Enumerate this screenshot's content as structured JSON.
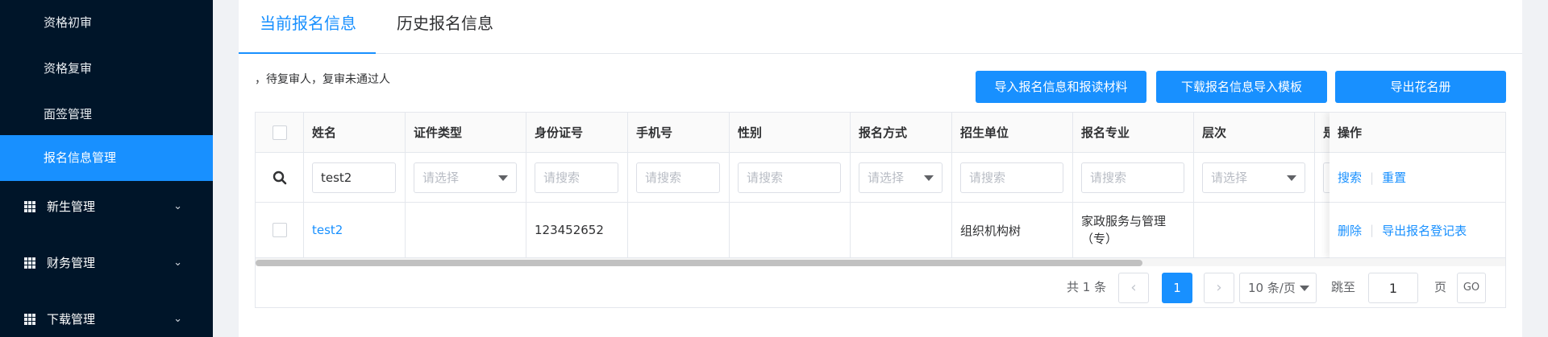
{
  "sidebar": {
    "sub_items": [
      {
        "label": "资格初审"
      },
      {
        "label": "资格复审"
      },
      {
        "label": "面签管理"
      },
      {
        "label": "报名信息管理"
      }
    ],
    "groups": [
      {
        "label": "新生管理"
      },
      {
        "label": "财务管理"
      },
      {
        "label": "下载管理"
      }
    ]
  },
  "tabs": [
    {
      "label": "当前报名信息"
    },
    {
      "label": "历史报名信息"
    }
  ],
  "hint_text": "，待复审人，复审未通过人",
  "buttons": {
    "import": "导入报名信息和报读材料",
    "download_template": "下载报名信息导入模板",
    "export": "导出花名册"
  },
  "table": {
    "columns": [
      "姓名",
      "证件类型",
      "身份证号",
      "手机号",
      "性别",
      "报名方式",
      "招生单位",
      "报名专业",
      "层次",
      "是"
    ],
    "ops_header": "操作",
    "filters": {
      "name_value": "test2",
      "select_placeholder": "请选择",
      "search_placeholder": "请搜索",
      "search_link": "搜索",
      "reset_link": "重置"
    },
    "rows": [
      {
        "name": "test2",
        "id_type": "",
        "id_number": "123452652",
        "phone": "",
        "gender": "",
        "method": "",
        "unit": "组织机构树",
        "major_line1": "家政服务与管理",
        "major_line2": "（专）",
        "level": "",
        "ops": [
          "删除",
          "导出报名登记表"
        ]
      }
    ]
  },
  "pagination": {
    "total_text": "共 1 条",
    "current_page": "1",
    "page_size": "10 条/页",
    "jump_label": "跳至",
    "jump_value": "1",
    "page_suffix": "页",
    "go_label": "GO"
  },
  "colors": {
    "accent": "#1890ff",
    "sidebar_bg": "#001529"
  }
}
